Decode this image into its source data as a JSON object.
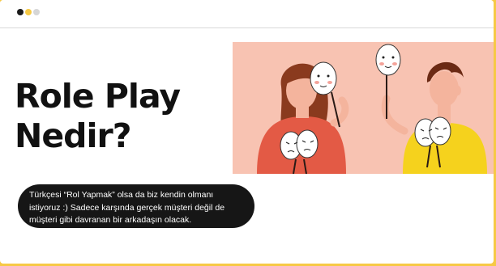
{
  "window": {
    "controls": [
      "close",
      "minimize",
      "maximize"
    ]
  },
  "hero": {
    "title_line1": "Role Play",
    "title_line2": "Nedir?",
    "description": "Türkçesi “Rol Yapmak” olsa da biz kendin olmanı istiyoruz :) Sadece karşında gerçek müşteri değil de müşteri gibi davranan bir arkadaşın olacak."
  },
  "illustration": {
    "subject": "two people holding face masks",
    "colors": {
      "background": "#f8c3b2",
      "woman_shirt": "#e35a45",
      "man_shirt": "#f5d21d",
      "hair": "#8a3a1e"
    }
  }
}
